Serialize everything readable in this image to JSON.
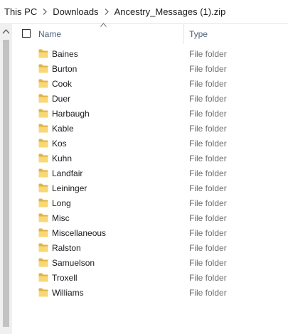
{
  "breadcrumb": {
    "items": [
      "This PC",
      "Downloads",
      "Ancestry_Messages (1).zip"
    ]
  },
  "columns": {
    "name": "Name",
    "type": "Type",
    "sort_direction": "ascending"
  },
  "icons": {
    "folder": "folder-icon",
    "separator": "chevron-right-icon",
    "scroll_up": "scroll-up-arrow-icon",
    "sort": "sort-up-arrow-icon"
  },
  "colors": {
    "folder": "#f8d775",
    "header_text": "#4c607a",
    "type_text": "#6d6d6d"
  },
  "rows": [
    {
      "name": "Baines",
      "type": "File folder"
    },
    {
      "name": "Burton",
      "type": "File folder"
    },
    {
      "name": "Cook",
      "type": "File folder"
    },
    {
      "name": "Duer",
      "type": "File folder"
    },
    {
      "name": "Harbaugh",
      "type": "File folder"
    },
    {
      "name": "Kable",
      "type": "File folder"
    },
    {
      "name": "Kos",
      "type": "File folder"
    },
    {
      "name": "Kuhn",
      "type": "File folder"
    },
    {
      "name": "Landfair",
      "type": "File folder"
    },
    {
      "name": "Leininger",
      "type": "File folder"
    },
    {
      "name": "Long",
      "type": "File folder"
    },
    {
      "name": "Misc",
      "type": "File folder"
    },
    {
      "name": "Miscellaneous",
      "type": "File folder"
    },
    {
      "name": "Ralston",
      "type": "File folder"
    },
    {
      "name": "Samuelson",
      "type": "File folder"
    },
    {
      "name": "Troxell",
      "type": "File folder"
    },
    {
      "name": "Williams",
      "type": "File folder"
    }
  ]
}
